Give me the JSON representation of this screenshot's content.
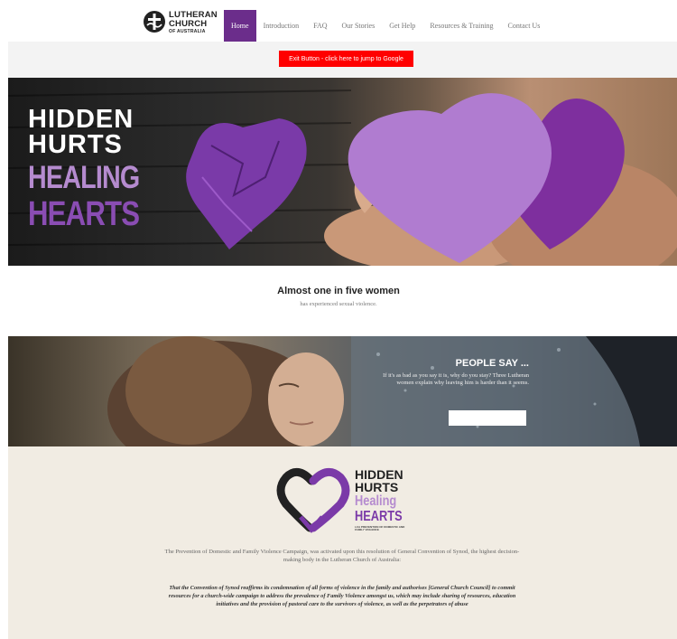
{
  "header": {
    "logo": {
      "line1": "LUTHERAN",
      "line2": "CHURCH",
      "line3": "OF AUSTRALIA"
    },
    "nav": [
      {
        "label": "Home",
        "active": true
      },
      {
        "label": "Introduction",
        "active": false
      },
      {
        "label": "FAQ",
        "active": false
      },
      {
        "label": "Our Stories",
        "active": false
      },
      {
        "label": "Get Help",
        "active": false
      },
      {
        "label": "Resources & Training",
        "active": false
      },
      {
        "label": "Contact Us",
        "active": false
      }
    ]
  },
  "exit_button": {
    "label": "Exit Button - click here to jump to Google",
    "color": "#ff0000"
  },
  "hero": {
    "line1": "HIDDEN",
    "line2": "HURTS",
    "line3": "HEALING",
    "line4": "HEARTS"
  },
  "stat": {
    "heading": "Almost one in five women",
    "sub": "has experienced sexual violence."
  },
  "people_say": {
    "title": "PEOPLE SAY ...",
    "text": "If it's as bad as you say it is, why do you stay? Three Lutheran women explain why leaving him is harder than it seems.",
    "button_label": ""
  },
  "campaign": {
    "logo": {
      "line1": "HIDDEN",
      "line2": "HURTS",
      "line3": "Healing",
      "line4": "HEARTS",
      "tagline": "LCA PREVENTION OF DOMESTIC AND FAMILY VIOLENCE"
    },
    "paragraph": "The Prevention of Domestic and Family Violence Campaign, was activated upon this resolution of General Convention of Synod, the highest decision-making body in the Lutheran Church of Australia:",
    "quote": "That the Convention of Synod reaffirms its condemnation of all forms of violence in the family and authorises [General Church Council] to commit resources for a church-wide campaign to address the prevalence of Family Violence amongst us, which may include sharing of resources, education initiatives and the provision of pastoral care to the survivors of violence, as well as the perpetrators of abuse"
  },
  "colors": {
    "brand_purple": "#6b2d8b",
    "light_purple": "#b58bcf",
    "exit_red": "#ff0000",
    "campaign_bg": "#f1ece3"
  }
}
